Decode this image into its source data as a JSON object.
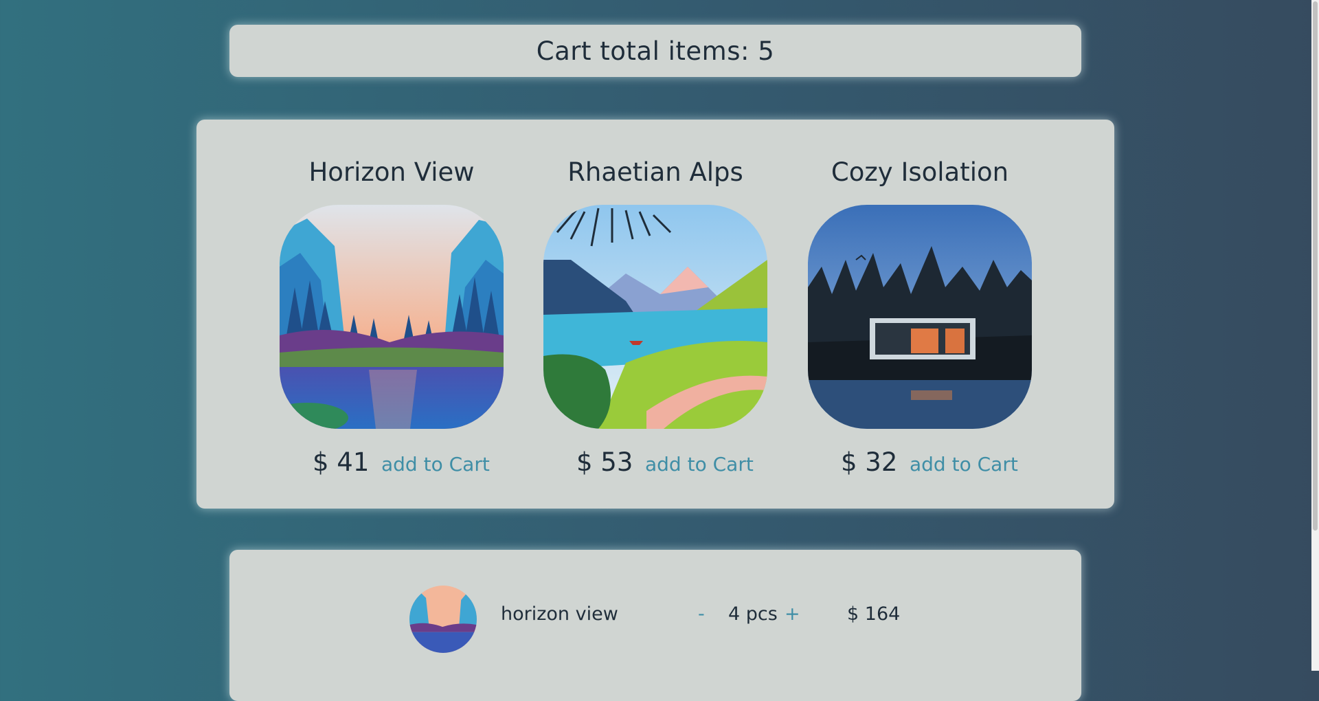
{
  "header": {
    "title": "Cart total items: 5"
  },
  "products": [
    {
      "name": "Horizon View",
      "price": "$ 41",
      "action": "add to Cart"
    },
    {
      "name": "Rhaetian Alps",
      "price": "$ 53",
      "action": "add to Cart"
    },
    {
      "name": "Cozy Isolation",
      "price": "$ 32",
      "action": "add to Cart"
    }
  ],
  "cart": {
    "items": [
      {
        "name": "horizon view",
        "decrement": "-",
        "quantity": "4 pcs",
        "increment": "+",
        "subtotal": "$ 164"
      }
    ]
  },
  "colors": {
    "panel": "#d0d5d2",
    "text": "#1f2d3a",
    "link": "#3f8ea6"
  }
}
